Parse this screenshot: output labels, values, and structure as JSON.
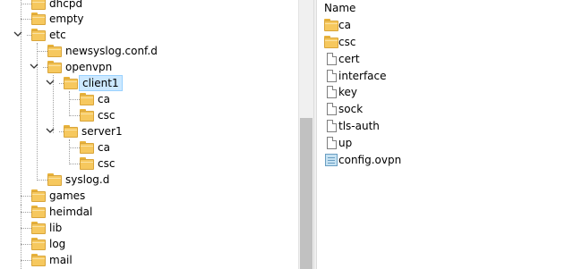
{
  "tree": {
    "nodes": [
      {
        "id": "dhcpd",
        "label": "dhcpd"
      },
      {
        "id": "empty",
        "label": "empty"
      },
      {
        "id": "etc",
        "label": "etc",
        "expanded": true
      },
      {
        "id": "newsyslog",
        "label": "newsyslog.conf.d"
      },
      {
        "id": "openvpn",
        "label": "openvpn",
        "expanded": true
      },
      {
        "id": "client1",
        "label": "client1",
        "expanded": true,
        "selected": true
      },
      {
        "id": "client1-ca",
        "label": "ca"
      },
      {
        "id": "client1-csc",
        "label": "csc"
      },
      {
        "id": "server1",
        "label": "server1",
        "expanded": true
      },
      {
        "id": "server1-ca",
        "label": "ca"
      },
      {
        "id": "server1-csc",
        "label": "csc"
      },
      {
        "id": "syslog",
        "label": "syslog.d"
      },
      {
        "id": "games",
        "label": "games"
      },
      {
        "id": "heimdal",
        "label": "heimdal"
      },
      {
        "id": "lib",
        "label": "lib"
      },
      {
        "id": "log",
        "label": "log"
      },
      {
        "id": "mail",
        "label": "mail"
      }
    ]
  },
  "list": {
    "header": "Name",
    "items": [
      {
        "name": "ca",
        "type": "folder"
      },
      {
        "name": "csc",
        "type": "folder"
      },
      {
        "name": "cert",
        "type": "file"
      },
      {
        "name": "interface",
        "type": "file"
      },
      {
        "name": "key",
        "type": "file"
      },
      {
        "name": "sock",
        "type": "file"
      },
      {
        "name": "tls-auth",
        "type": "file"
      },
      {
        "name": "up",
        "type": "file"
      },
      {
        "name": "config.ovpn",
        "type": "config"
      }
    ]
  },
  "colors": {
    "selection": "#cce8ff",
    "selection_border": "#99d1ff",
    "folder": "#f6c85e"
  }
}
